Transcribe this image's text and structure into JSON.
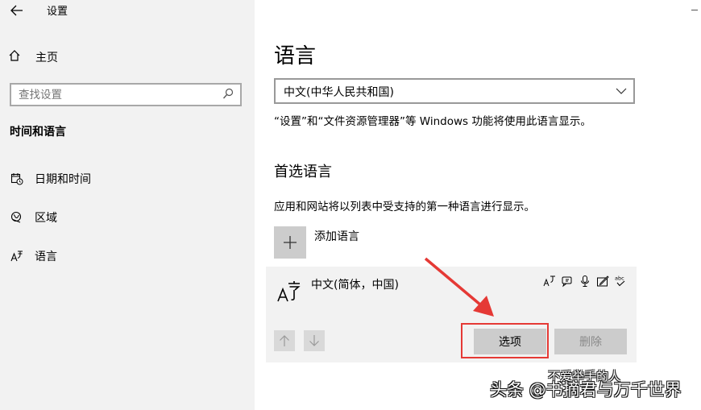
{
  "window": {
    "title": "设置"
  },
  "sidebar": {
    "home_label": "主页",
    "search_placeholder": "查找设置",
    "section_title": "时间和语言",
    "items": [
      {
        "label": "日期和时间",
        "icon": "calendar-clock-icon"
      },
      {
        "label": "区域",
        "icon": "globe-icon"
      },
      {
        "label": "语言",
        "icon": "language-icon"
      }
    ]
  },
  "main": {
    "title": "语言",
    "display_language": {
      "selected": "中文(中华人民共和国)"
    },
    "display_language_desc": "“设置”和“文件资源管理器”等 Windows 功能将使用此语言显示。",
    "preferred_title": "首选语言",
    "preferred_desc": "应用和网站将以列表中受支持的第一种语言进行显示。",
    "add_language_label": "添加语言",
    "languages": [
      {
        "name": "中文(简体，中国)",
        "features": [
          "display-language-icon",
          "speech-icon",
          "microphone-icon",
          "handwriting-icon",
          "spellcheck-icon"
        ],
        "options_label": "选项",
        "remove_label": "删除"
      }
    ]
  },
  "annotation": {
    "highlight_color": "#e53935"
  },
  "watermark": {
    "text": "头条 @书摘君与万千世界",
    "sub": "不爱举手的人"
  },
  "colors": {
    "sidebar_bg": "#f2f2f2",
    "card_bg": "#f2f2f2",
    "button_bg": "#cccccc"
  }
}
